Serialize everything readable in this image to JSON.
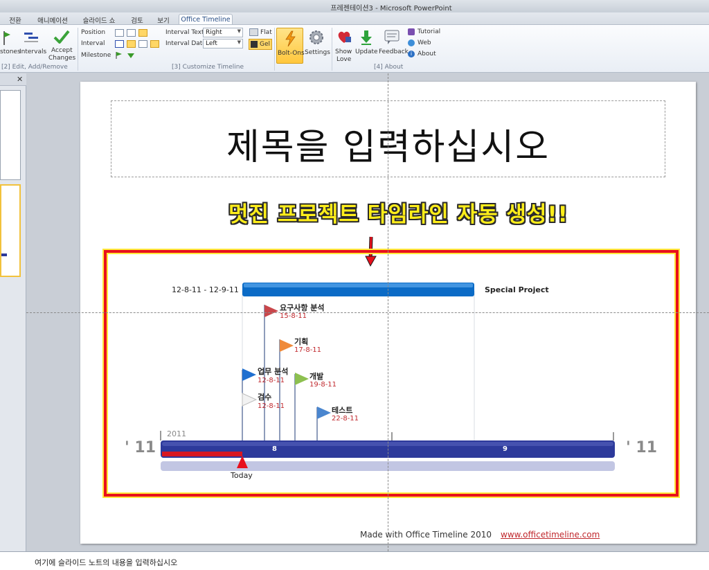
{
  "window": {
    "title": "프레젠테이션3 - Microsoft PowerPoint"
  },
  "tabs": [
    {
      "label": "전환"
    },
    {
      "label": "애니메이션"
    },
    {
      "label": "슬라이드 쇼"
    },
    {
      "label": "검토"
    },
    {
      "label": "보기"
    },
    {
      "label": "Office Timeline",
      "active": true
    }
  ],
  "ribbon": {
    "edit": {
      "milestones_label": "stones",
      "intervals_label": "Intervals",
      "accept_label_1": "Accept",
      "accept_label_2": "Changes",
      "group_label": "[2] Edit, Add/Remove"
    },
    "customize": {
      "position_label": "Position",
      "interval_label": "Interval",
      "milestone_label": "Milestone",
      "interval_text_label": "Interval Text",
      "interval_text_value": "Right",
      "interval_date_label": "Interval Date",
      "interval_date_value": "Left",
      "flat_label": "Flat",
      "gel_label": "Gel",
      "group_label": "[3] Customize Timeline"
    },
    "tools": {
      "bolt_ons_label": "Bolt-Ons",
      "settings_label": "Settings"
    },
    "about": {
      "show_love_1": "Show",
      "show_love_2": "Love",
      "update_label": "Update",
      "feedback_label": "Feedback",
      "tutorial_label": "Tutorial",
      "web_label": "Web",
      "about_label": "About",
      "group_label": "[4] About"
    }
  },
  "slide": {
    "title_placeholder": "제목을 입력하십시오",
    "subtitle": "멋진 프로젝트 타임라인 자동 생성!!",
    "footer_text": "Made with Office Timeline 2010",
    "footer_link": "www.officetimeline.com",
    "accent_red": "#e8101c",
    "accent_yellow": "#ffe93a"
  },
  "timeline": {
    "year_label": "2011",
    "left_year": "' 11",
    "right_year": "' 11",
    "month_8": "8",
    "month_9": "9",
    "today_label": "Today",
    "project": {
      "range": "12-8-11 - 12-9-11",
      "name": "Special Project"
    },
    "milestones": [
      {
        "title": "요구사항 분석",
        "date": "15-8-11",
        "color": "#c9474b"
      },
      {
        "title": "기획",
        "date": "17-8-11",
        "color": "#ef8a3a"
      },
      {
        "title": "업무 분석",
        "date": "12-8-11",
        "color": "#1f6fd0"
      },
      {
        "title": "개발",
        "date": "19-8-11",
        "color": "#8dc050"
      },
      {
        "title": "검수",
        "date": "12-8-11",
        "color": "#e2e2e2"
      },
      {
        "title": "테스트",
        "date": "22-8-11",
        "color": "#4a86cf"
      }
    ],
    "bar_color": "#2d3a9b"
  },
  "notes": {
    "placeholder": "여기에 슬라이드 노트의 내용을 입력하십시오"
  }
}
